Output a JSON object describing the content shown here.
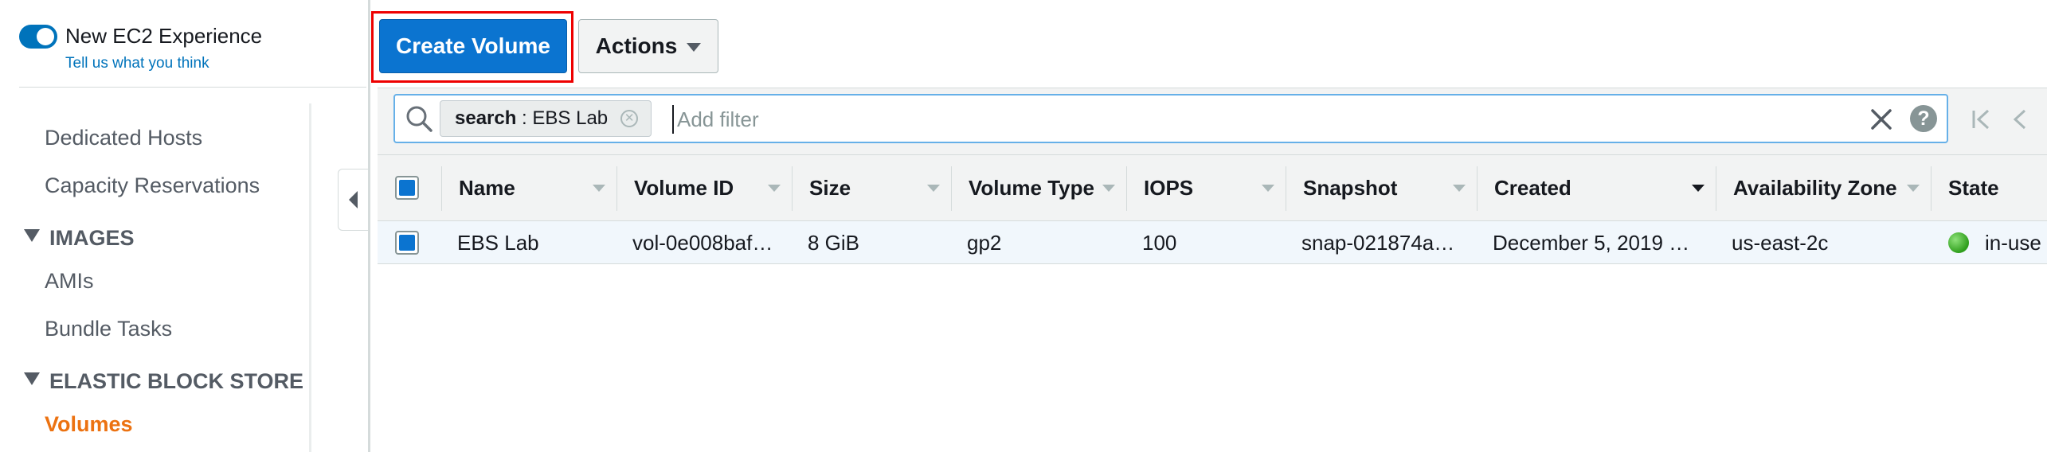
{
  "sidebar": {
    "experience_title": "New EC2 Experience",
    "experience_link": "Tell us what you think",
    "items": [
      {
        "label": "Dedicated Hosts"
      },
      {
        "label": "Capacity Reservations"
      }
    ],
    "sections": [
      {
        "label": "IMAGES",
        "items": [
          {
            "label": "AMIs"
          },
          {
            "label": "Bundle Tasks"
          }
        ]
      },
      {
        "label": "ELASTIC BLOCK STORE",
        "items": [
          {
            "label": "Volumes",
            "active": true
          }
        ]
      }
    ]
  },
  "toolbar": {
    "create_label": "Create Volume",
    "actions_label": "Actions"
  },
  "filter": {
    "chip_key": "search",
    "chip_sep": " : ",
    "chip_value": "EBS Lab",
    "placeholder": "Add filter"
  },
  "table": {
    "columns": [
      "Name",
      "Volume ID",
      "Size",
      "Volume Type",
      "IOPS",
      "Snapshot",
      "Created",
      "Availability Zone",
      "State"
    ],
    "rows": [
      {
        "name": "EBS Lab",
        "volume_id": "vol-0e008baf…",
        "size": "8 GiB",
        "volume_type": "gp2",
        "iops": "100",
        "snapshot": "snap-021874a…",
        "created": "December 5, 2019 …",
        "availability_zone": "us-east-2c",
        "state": "in-use"
      }
    ]
  },
  "colors": {
    "primary": "#0b74d0",
    "accent_active": "#ec7211",
    "status_ok": "#2f9e1c",
    "highlight": "#e00000"
  }
}
